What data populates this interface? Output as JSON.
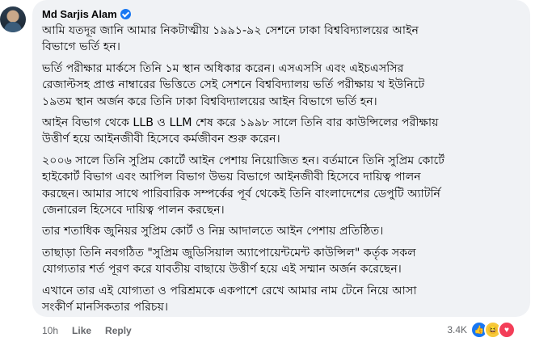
{
  "comment": {
    "author": "Md Sarjis Alam",
    "paragraphs": [
      "আমি যতদূর জানি আমার নিকটাত্মীয় ১৯৯১-৯২ সেশনে ঢাকা বিশ্ববিদ্যালয়ের আইন\nবিভাগে ভর্তি হন।",
      "ভর্তি পরীক্ষার মার্কসে তিনি ১ম স্থান অধিকার করেন। এসএসসি এবং এইচএসসির\nরেজাল্টসহ প্রাপ্ত নাম্বারের ভিত্তিতে সেই সেশনে বিশ্ববিদ্যালয় ভর্তি পরীক্ষায় খ ইউনিটে\n১৯তম স্থান অর্জন করে তিনি ঢাকা বিশ্ববিদ্যালয়ের আইন বিভাগে ভর্তি হন।",
      "আইন বিভাগ থেকে LLB ও LLM শেষ করে ১৯৯৮ সালে তিনি বার কাউন্সিলের পরীক্ষায়\nউত্তীর্ণ হয়ে আইনজীবী হিসেবে কর্মজীবন শুরু করেন।",
      "২০০৬ সালে তিনি সুপ্রিম কোর্টে আইন পেশায় নিয়োজিত হন। বর্তমানে তিনি সুপ্রিম কোর্টে\nহাইকোর্ট বিভাগ এবং আপিল বিভাগ উভয় বিভাগে আইনজীবী হিসেবে দায়িত্ব পালন\nকরছেন। আমার সাথে পারিবারিক সম্পর্কের পূর্ব থেকেই তিনি বাংলাদেশের ডেপুটি অ্যাটর্নি\nজেনারেল হিসেবে দায়িত্ব পালন করছেন।",
      "তার শতাধিক জুনিয়র সুপ্রিম কোর্ট ও নিম্ন আদালতে আইন পেশায় প্রতিষ্ঠিত।",
      "তাছাড়া তিনি নবগঠিত \"সুপ্রিম জুডিসিয়াল অ্যাপোয়েন্টমেন্ট কাউন্সিল\" কর্তৃক সকল\nযোগ্যতার শর্ত পূরণ করে যাবতীয় বাছায়ে উত্তীর্ণ হয়ে এই সম্মান অর্জন করেছেন।",
      "এখানে তার এই যোগ্যতা ও পরিশ্রমকে একপাশে রেখে আমার নাম টেনে নিয়ে আসা\nসংকীর্ণ মানসিকতার পরিচয়।"
    ]
  },
  "footer": {
    "time": "10h",
    "like_label": "Like",
    "reply_label": "Reply"
  },
  "reactions": {
    "count": "3.4K",
    "icons": [
      "like-icon",
      "haha-icon",
      "love-icon"
    ]
  },
  "colors": {
    "bubble": "#f0f2f5",
    "text": "#050505",
    "muted": "#65676b",
    "verified": "#1877f2"
  }
}
